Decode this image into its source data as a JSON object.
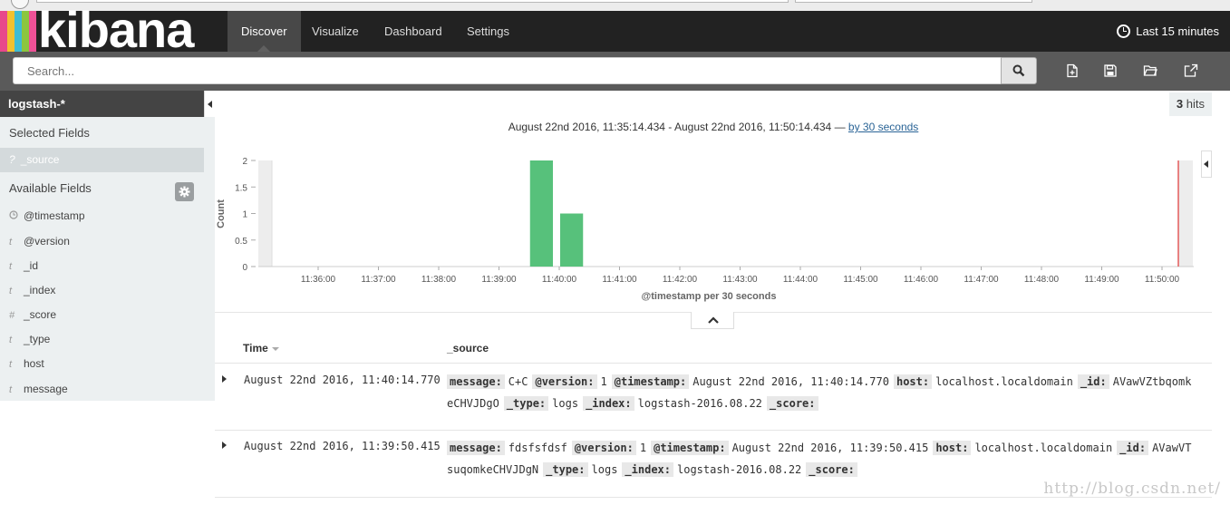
{
  "brand": {
    "logo_text": "kibana",
    "stripe_colors": [
      "#e8488b",
      "#f2c12e",
      "#3fbcd3",
      "#8cc63f",
      "#ee5197"
    ]
  },
  "nav": {
    "tabs": [
      {
        "label": "Discover",
        "active": true
      },
      {
        "label": "Visualize",
        "active": false
      },
      {
        "label": "Dashboard",
        "active": false
      },
      {
        "label": "Settings",
        "active": false
      }
    ],
    "time_picker": "Last 15 minutes"
  },
  "search": {
    "placeholder": "Search...",
    "value": ""
  },
  "toolbar": {
    "icons": [
      "new-search-icon",
      "save-icon",
      "open-folder-icon",
      "share-icon"
    ]
  },
  "sidebar": {
    "index_pattern": "logstash-*",
    "selected_title": "Selected Fields",
    "selected_fields": [
      {
        "type": "?",
        "name": "_source"
      }
    ],
    "available_title": "Available Fields",
    "available_fields": [
      {
        "type": "clock",
        "name": "@timestamp"
      },
      {
        "type": "t",
        "name": "@version"
      },
      {
        "type": "t",
        "name": "_id"
      },
      {
        "type": "t",
        "name": "_index"
      },
      {
        "type": "#",
        "name": "_score"
      },
      {
        "type": "t",
        "name": "_type"
      },
      {
        "type": "t",
        "name": "host"
      },
      {
        "type": "t",
        "name": "message"
      }
    ]
  },
  "results": {
    "hits_count": "3",
    "hits_label": "hits",
    "time_range": "August 22nd 2016, 11:35:14.434 - August 22nd 2016, 11:50:14.434 —",
    "interval_link": "by 30 seconds",
    "columns": {
      "time": "Time",
      "source": "_source"
    },
    "rows": [
      {
        "time": "August 22nd 2016, 11:40:14.770",
        "line1": [
          {
            "k": "message:",
            "v": "C+C"
          },
          {
            "k": "@version:",
            "v": "1"
          },
          {
            "k": "@timestamp:",
            "v": "August 22nd 2016, 11:40:14.770"
          },
          {
            "k": "host:",
            "v": "localhost.localdomain"
          },
          {
            "k": "_id:",
            "v": "AVawVZtbqomk"
          }
        ],
        "line2": [
          {
            "k": "",
            "v": "eCHVJDgO"
          },
          {
            "k": "_type:",
            "v": "logs"
          },
          {
            "k": "_index:",
            "v": "logstash-2016.08.22"
          },
          {
            "k": "_score:",
            "v": ""
          }
        ]
      },
      {
        "time": "August 22nd 2016, 11:39:50.415",
        "line1": [
          {
            "k": "message:",
            "v": "fdsfsfdsf"
          },
          {
            "k": "@version:",
            "v": "1"
          },
          {
            "k": "@timestamp:",
            "v": "August 22nd 2016, 11:39:50.415"
          },
          {
            "k": "host:",
            "v": "localhost.localdomain"
          },
          {
            "k": "_id:",
            "v": "AVawVT"
          }
        ],
        "line2": [
          {
            "k": "",
            "v": "suqomkeCHVJDgN"
          },
          {
            "k": "_type:",
            "v": "logs"
          },
          {
            "k": "_index:",
            "v": "logstash-2016.08.22"
          },
          {
            "k": "_score:",
            "v": ""
          }
        ]
      }
    ]
  },
  "chart_data": {
    "type": "bar",
    "ylabel": "Count",
    "xlabel": "@timestamp per 30 seconds",
    "ylim": [
      0,
      2
    ],
    "y_ticks": [
      "0",
      "0.5",
      "1",
      "1.5",
      "2"
    ],
    "x_ticks": [
      "11:36:00",
      "11:37:00",
      "11:38:00",
      "11:39:00",
      "11:40:00",
      "11:41:00",
      "11:42:00",
      "11:43:00",
      "11:44:00",
      "11:45:00",
      "11:46:00",
      "11:47:00",
      "11:48:00",
      "11:49:00",
      "11:50:00"
    ],
    "bars": [
      {
        "x": "11:39:30",
        "value": 2
      },
      {
        "x": "11:40:00",
        "value": 1
      }
    ],
    "bar_color": "#57c17b",
    "now_marker_color": "#e35b5b"
  },
  "watermark": "http://blog.csdn.net/"
}
